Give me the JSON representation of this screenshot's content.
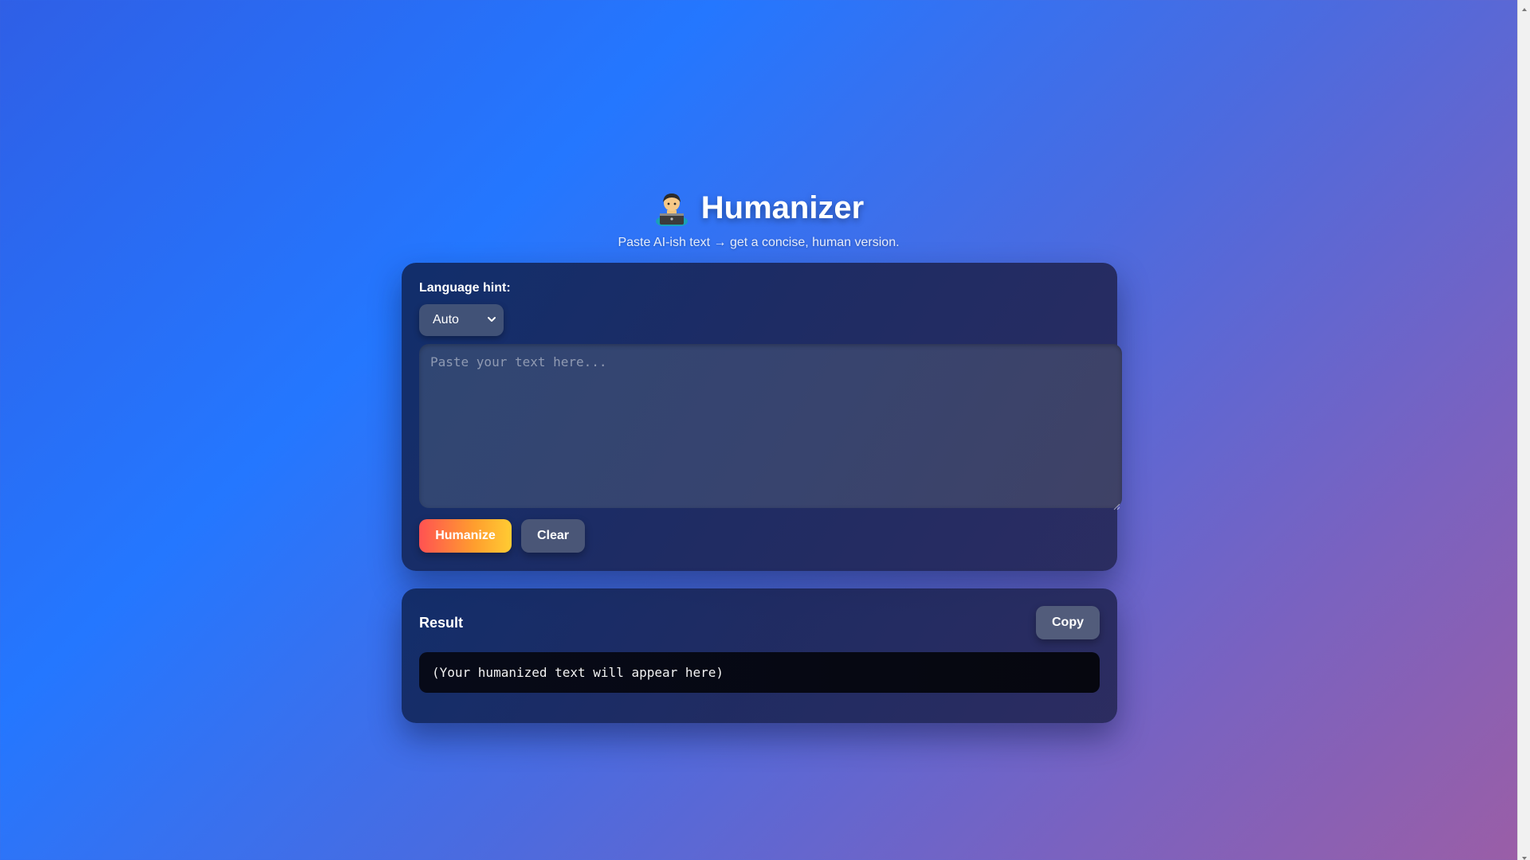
{
  "header": {
    "icon": "technologist-emoji-icon",
    "title": "Humanizer",
    "subtitle": "Paste AI-ish text → get a concise, human version."
  },
  "input_card": {
    "language_label": "Language hint:",
    "language_selected": "Auto",
    "textarea_placeholder": "Paste your text here...",
    "textarea_value": "",
    "humanize_label": "Humanize",
    "clear_label": "Clear"
  },
  "result_card": {
    "title": "Result",
    "copy_label": "Copy",
    "output_text": "(Your humanized text will appear here)"
  },
  "colors": {
    "accent_gradient_start": "#ff5252",
    "accent_gradient_end": "#ffcc33",
    "card_bg": "#1c2a5c",
    "page_bg_start": "#2477ff",
    "page_bg_end": "#9b5ea6"
  }
}
